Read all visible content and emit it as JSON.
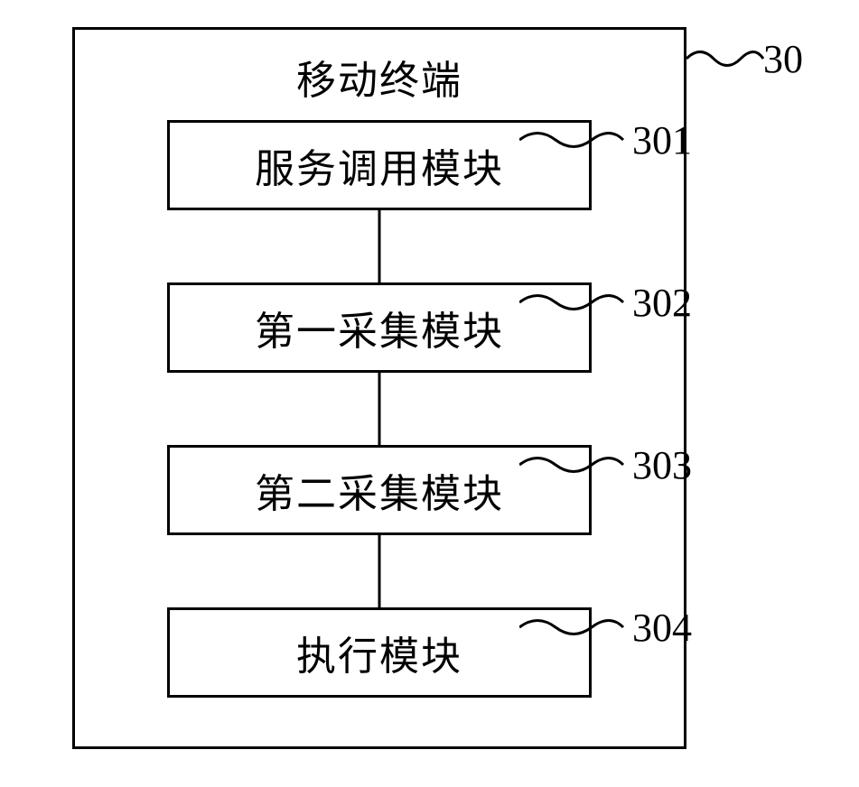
{
  "diagram": {
    "container_title": "移动终端",
    "container_ref": "30",
    "modules": [
      {
        "label": "服务调用模块",
        "ref": "301"
      },
      {
        "label": "第一采集模块",
        "ref": "302"
      },
      {
        "label": "第二采集模块",
        "ref": "303"
      },
      {
        "label": "执行模块",
        "ref": "304"
      }
    ]
  }
}
